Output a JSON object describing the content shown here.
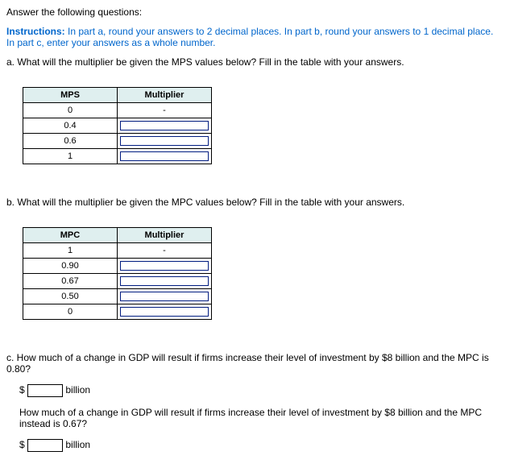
{
  "title": "Answer the following questions:",
  "instructions": {
    "label": "Instructions:",
    "text": " In part a, round your answers to 2 decimal places. In part b, round your answers to 1 decimal place. In part c, enter your answers as a whole number."
  },
  "partA": {
    "prompt": "a. What will the multiplier be given the MPS values below? Fill in the table with your answers.",
    "headers": {
      "col1": "MPS",
      "col2": "Multiplier"
    },
    "rows": [
      {
        "v": "0",
        "ans": "-"
      },
      {
        "v": "0.4",
        "ans": ""
      },
      {
        "v": "0.6",
        "ans": ""
      },
      {
        "v": "1",
        "ans": ""
      }
    ]
  },
  "partB": {
    "prompt": "b. What will the multiplier be given the MPC values below? Fill in the table with your answers.",
    "headers": {
      "col1": "MPC",
      "col2": "Multiplier"
    },
    "rows": [
      {
        "v": "1",
        "ans": "-"
      },
      {
        "v": "0.90",
        "ans": ""
      },
      {
        "v": "0.67",
        "ans": ""
      },
      {
        "v": "0.50",
        "ans": ""
      },
      {
        "v": "0",
        "ans": ""
      }
    ]
  },
  "partC": {
    "q1": "c. How much of a change in GDP will result if firms increase their level of investment by $8 billion and the MPC is 0.80?",
    "q2": "How much of a change in GDP will result if firms increase their level of investment by $8 billion and the MPC instead is 0.67?",
    "currency": "$",
    "unit": "billion"
  }
}
